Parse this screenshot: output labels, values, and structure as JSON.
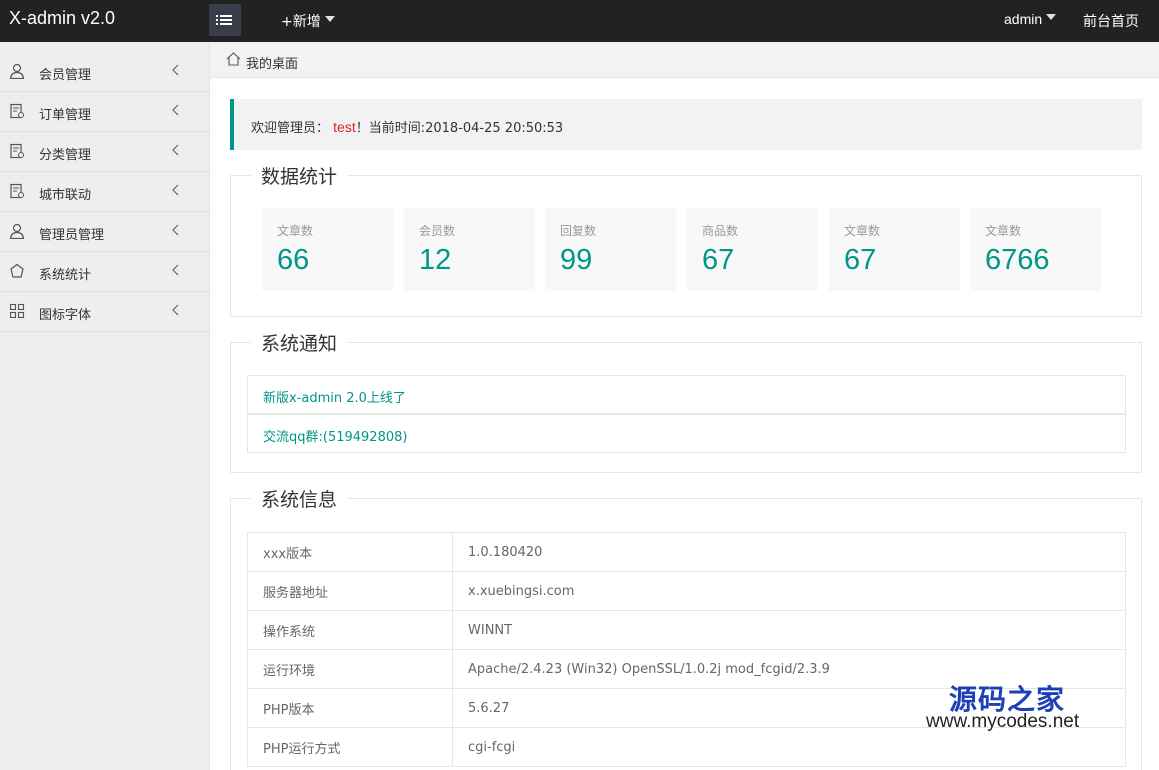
{
  "app": {
    "title": "X-admin v2.0"
  },
  "topbar": {
    "add_label": "+新增",
    "user_label": "admin",
    "front_label": "前台首页"
  },
  "sidebar": {
    "items": [
      {
        "label": "会员管理",
        "icon": "user-icon"
      },
      {
        "label": "订单管理",
        "icon": "order-icon"
      },
      {
        "label": "分类管理",
        "icon": "category-icon"
      },
      {
        "label": "城市联动",
        "icon": "city-icon"
      },
      {
        "label": "管理员管理",
        "icon": "admin-user-icon"
      },
      {
        "label": "系统统计",
        "icon": "statistics-icon"
      },
      {
        "label": "图标字体",
        "icon": "icon-font-icon"
      }
    ]
  },
  "breadcrumb": {
    "label": "我的桌面"
  },
  "welcome": {
    "prefix": "欢迎管理员：",
    "user": "test",
    "suffix": "！当前时间:2018-04-25 20:50:53"
  },
  "stats": {
    "title": "数据统计",
    "cards": [
      {
        "label": "文章数",
        "value": "66"
      },
      {
        "label": "会员数",
        "value": "12"
      },
      {
        "label": "回复数",
        "value": "99"
      },
      {
        "label": "商品数",
        "value": "67"
      },
      {
        "label": "文章数",
        "value": "67"
      },
      {
        "label": "文章数",
        "value": "6766"
      }
    ]
  },
  "notices": {
    "title": "系统通知",
    "items": [
      {
        "text": "新版x-admin 2.0上线了"
      },
      {
        "text": "交流qq群:(519492808)"
      }
    ]
  },
  "sysinfo": {
    "title": "系统信息",
    "rows": [
      {
        "key": "xxx版本",
        "value": "1.0.180420"
      },
      {
        "key": "服务器地址",
        "value": "x.xuebingsi.com"
      },
      {
        "key": "操作系统",
        "value": "WINNT"
      },
      {
        "key": "运行环境",
        "value": "Apache/2.4.23 (Win32) OpenSSL/1.0.2j mod_fcgid/2.3.9"
      },
      {
        "key": "PHP版本",
        "value": "5.6.27"
      },
      {
        "key": "PHP运行方式",
        "value": "cgi-fcgi"
      }
    ]
  },
  "watermark": {
    "title": "源码之家",
    "url": "www.mycodes.net"
  },
  "colors": {
    "accent": "#009688",
    "topbar": "#222222",
    "highlight": "#e2231a"
  }
}
